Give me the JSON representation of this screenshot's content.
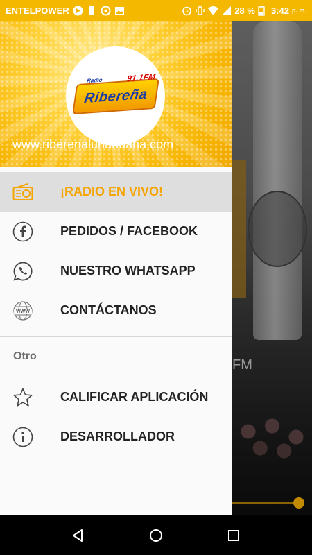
{
  "status_bar": {
    "carrier": "ENTELPOWER",
    "battery": "28 %",
    "time": "3:42",
    "ampm": "p. m."
  },
  "background": {
    "visible_text": "FM"
  },
  "drawer": {
    "logo": {
      "small_text": "Radio",
      "name": "Ribereña",
      "freq": "91.1FM"
    },
    "website": "www.riberenalunahuana.com",
    "main_items": [
      {
        "label": "¡RADIO EN VIVO!",
        "icon": "radio-icon",
        "active": true
      },
      {
        "label": "PEDIDOS / FACEBOOK",
        "icon": "facebook-icon",
        "active": false
      },
      {
        "label": "NUESTRO WHATSAPP",
        "icon": "whatsapp-icon",
        "active": false
      },
      {
        "label": "CONTÁCTANOS",
        "icon": "www-globe-icon",
        "active": false
      }
    ],
    "section_title": "Otro",
    "other_items": [
      {
        "label": "CALIFICAR APLICACIÓN",
        "icon": "star-icon"
      },
      {
        "label": "DESARROLLADOR",
        "icon": "info-icon"
      }
    ]
  },
  "colors": {
    "accent": "#f5a400",
    "header_yellow": "#ffd23a",
    "active_bg": "#dedede"
  }
}
